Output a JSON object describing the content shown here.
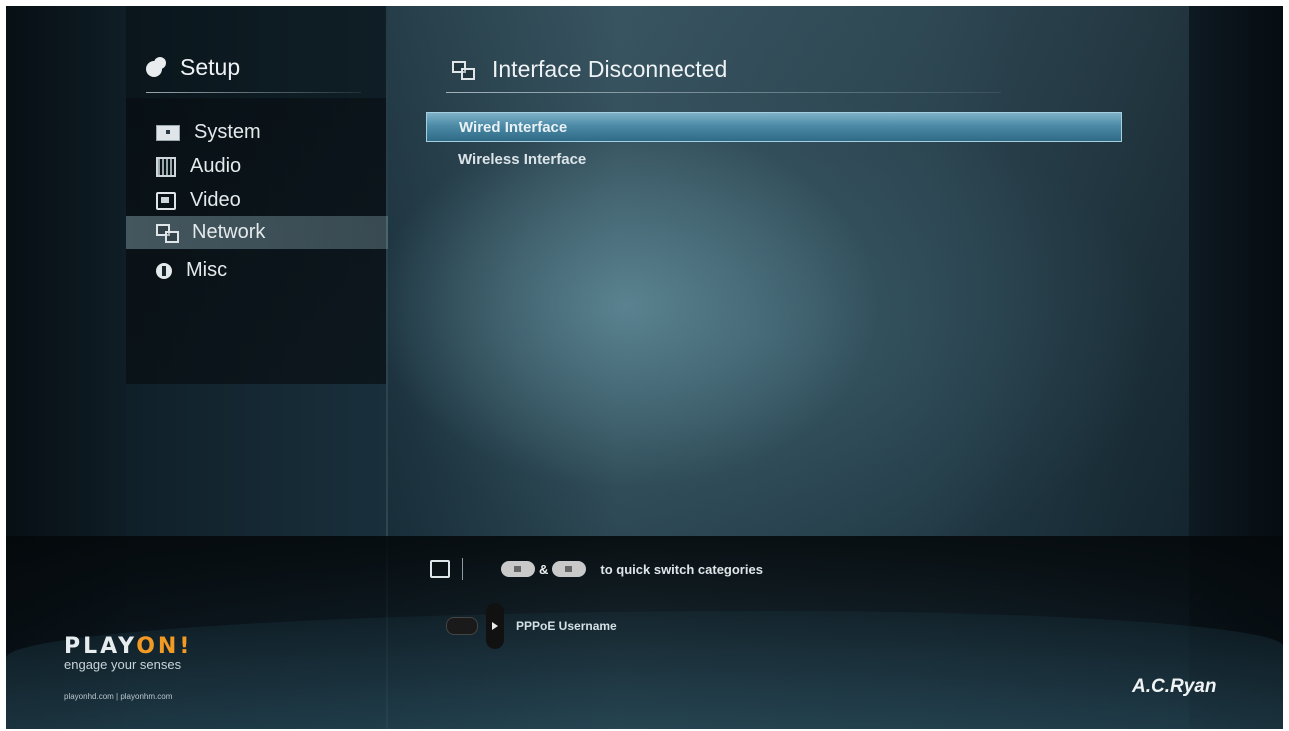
{
  "sidebar": {
    "title": "Setup",
    "items": [
      {
        "label": "System",
        "icon": "system-icon",
        "selected": false
      },
      {
        "label": "Audio",
        "icon": "audio-icon",
        "selected": false
      },
      {
        "label": "Video",
        "icon": "video-icon",
        "selected": false
      },
      {
        "label": "Network",
        "icon": "network-icon",
        "selected": true
      },
      {
        "label": "Misc",
        "icon": "misc-icon",
        "selected": false
      }
    ]
  },
  "main": {
    "title": "Interface Disconnected",
    "title_icon": "network-icon",
    "options": [
      {
        "label": "Wired Interface",
        "selected": true
      },
      {
        "label": "Wireless Interface",
        "selected": false
      }
    ]
  },
  "footer": {
    "hint_amp": "&",
    "hint_text": "to quick switch categories",
    "help_text": "PPPoE Username",
    "logo": {
      "word_start": "PLAY",
      "word_end": "ON!",
      "tagline": "engage your senses",
      "sites": "playonhd.com | playonhm.com"
    },
    "brand": "A.C.Ryan"
  },
  "colors": {
    "selection_highlight": "#4c8aa6",
    "logo_accent": "#f29a23"
  }
}
